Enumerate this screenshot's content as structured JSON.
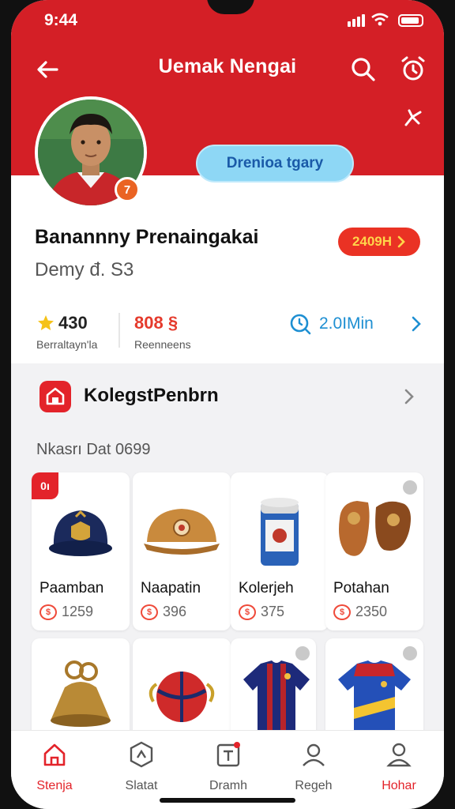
{
  "status_bar": {
    "time": "9:44"
  },
  "header": {
    "title": "Uemak Nengai"
  },
  "profile": {
    "avatar_badge": "7",
    "premium_label": "Drenioa tgary",
    "name": "Banannny Prenaingakai",
    "subtitle": "Demy đ. S3",
    "points_label": "2409H"
  },
  "stats": {
    "rating_value": "430",
    "rating_label": "Berraltayn'la",
    "second_value": "808 §",
    "second_label": "Reenneens",
    "time_value": "2.0IMin"
  },
  "collection": {
    "title": "KolegstPenbrn",
    "subheader": "Nkasrı Dat 0699"
  },
  "items": [
    {
      "name": "Paamban",
      "price": "1259",
      "badge": "0ı"
    },
    {
      "name": "Naapatin",
      "price": "396"
    },
    {
      "name": "Kolerjeh",
      "price": "375"
    },
    {
      "name": "Potahan",
      "price": "2350"
    }
  ],
  "bottom_nav": [
    {
      "label": "Stenja",
      "icon": "home-icon",
      "active": true
    },
    {
      "label": "Slatat",
      "icon": "hexagon-icon",
      "active": false
    },
    {
      "label": "Dramh",
      "icon": "note-icon",
      "active": false
    },
    {
      "label": "Regeh",
      "icon": "user-icon",
      "active": false
    },
    {
      "label": "Hohar",
      "icon": "profile-icon",
      "active": false
    }
  ],
  "colors": {
    "brand_red": "#d41f26",
    "premium_blue": "#8ed7f5",
    "accent_blue": "#1e8fd2"
  }
}
